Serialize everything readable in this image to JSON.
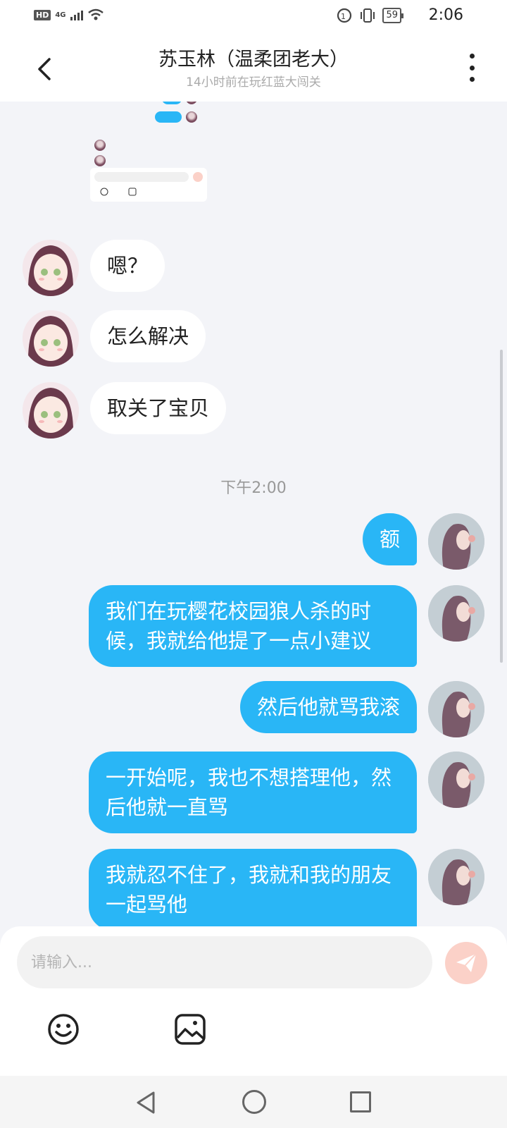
{
  "status_bar": {
    "hd": "HD",
    "network": "4G",
    "battery": "59",
    "time": "2:06"
  },
  "header": {
    "title": "苏玉林（温柔团老大）",
    "subtitle": "14小时前在玩红蓝大闯关"
  },
  "messages_incoming": [
    {
      "text": "嗯？"
    },
    {
      "text": "怎么解决"
    },
    {
      "text": "取关了宝贝"
    }
  ],
  "time_separator": "下午2:00",
  "messages_outgoing": [
    {
      "text": "额"
    },
    {
      "text": "我们在玩樱花校园狼人杀的时候，我就给他提了一点小建议"
    },
    {
      "text": "然后他就骂我滚"
    },
    {
      "text": "一开始呢，我也不想搭理他，然后他就一直骂"
    },
    {
      "text": "我就忍不住了，我就和我的朋友一起骂他"
    }
  ],
  "composer": {
    "placeholder": "请输入..."
  },
  "colors": {
    "accent": "#29b6f6",
    "send_disabled": "#fbd1c8",
    "background": "#f3f4f8"
  }
}
